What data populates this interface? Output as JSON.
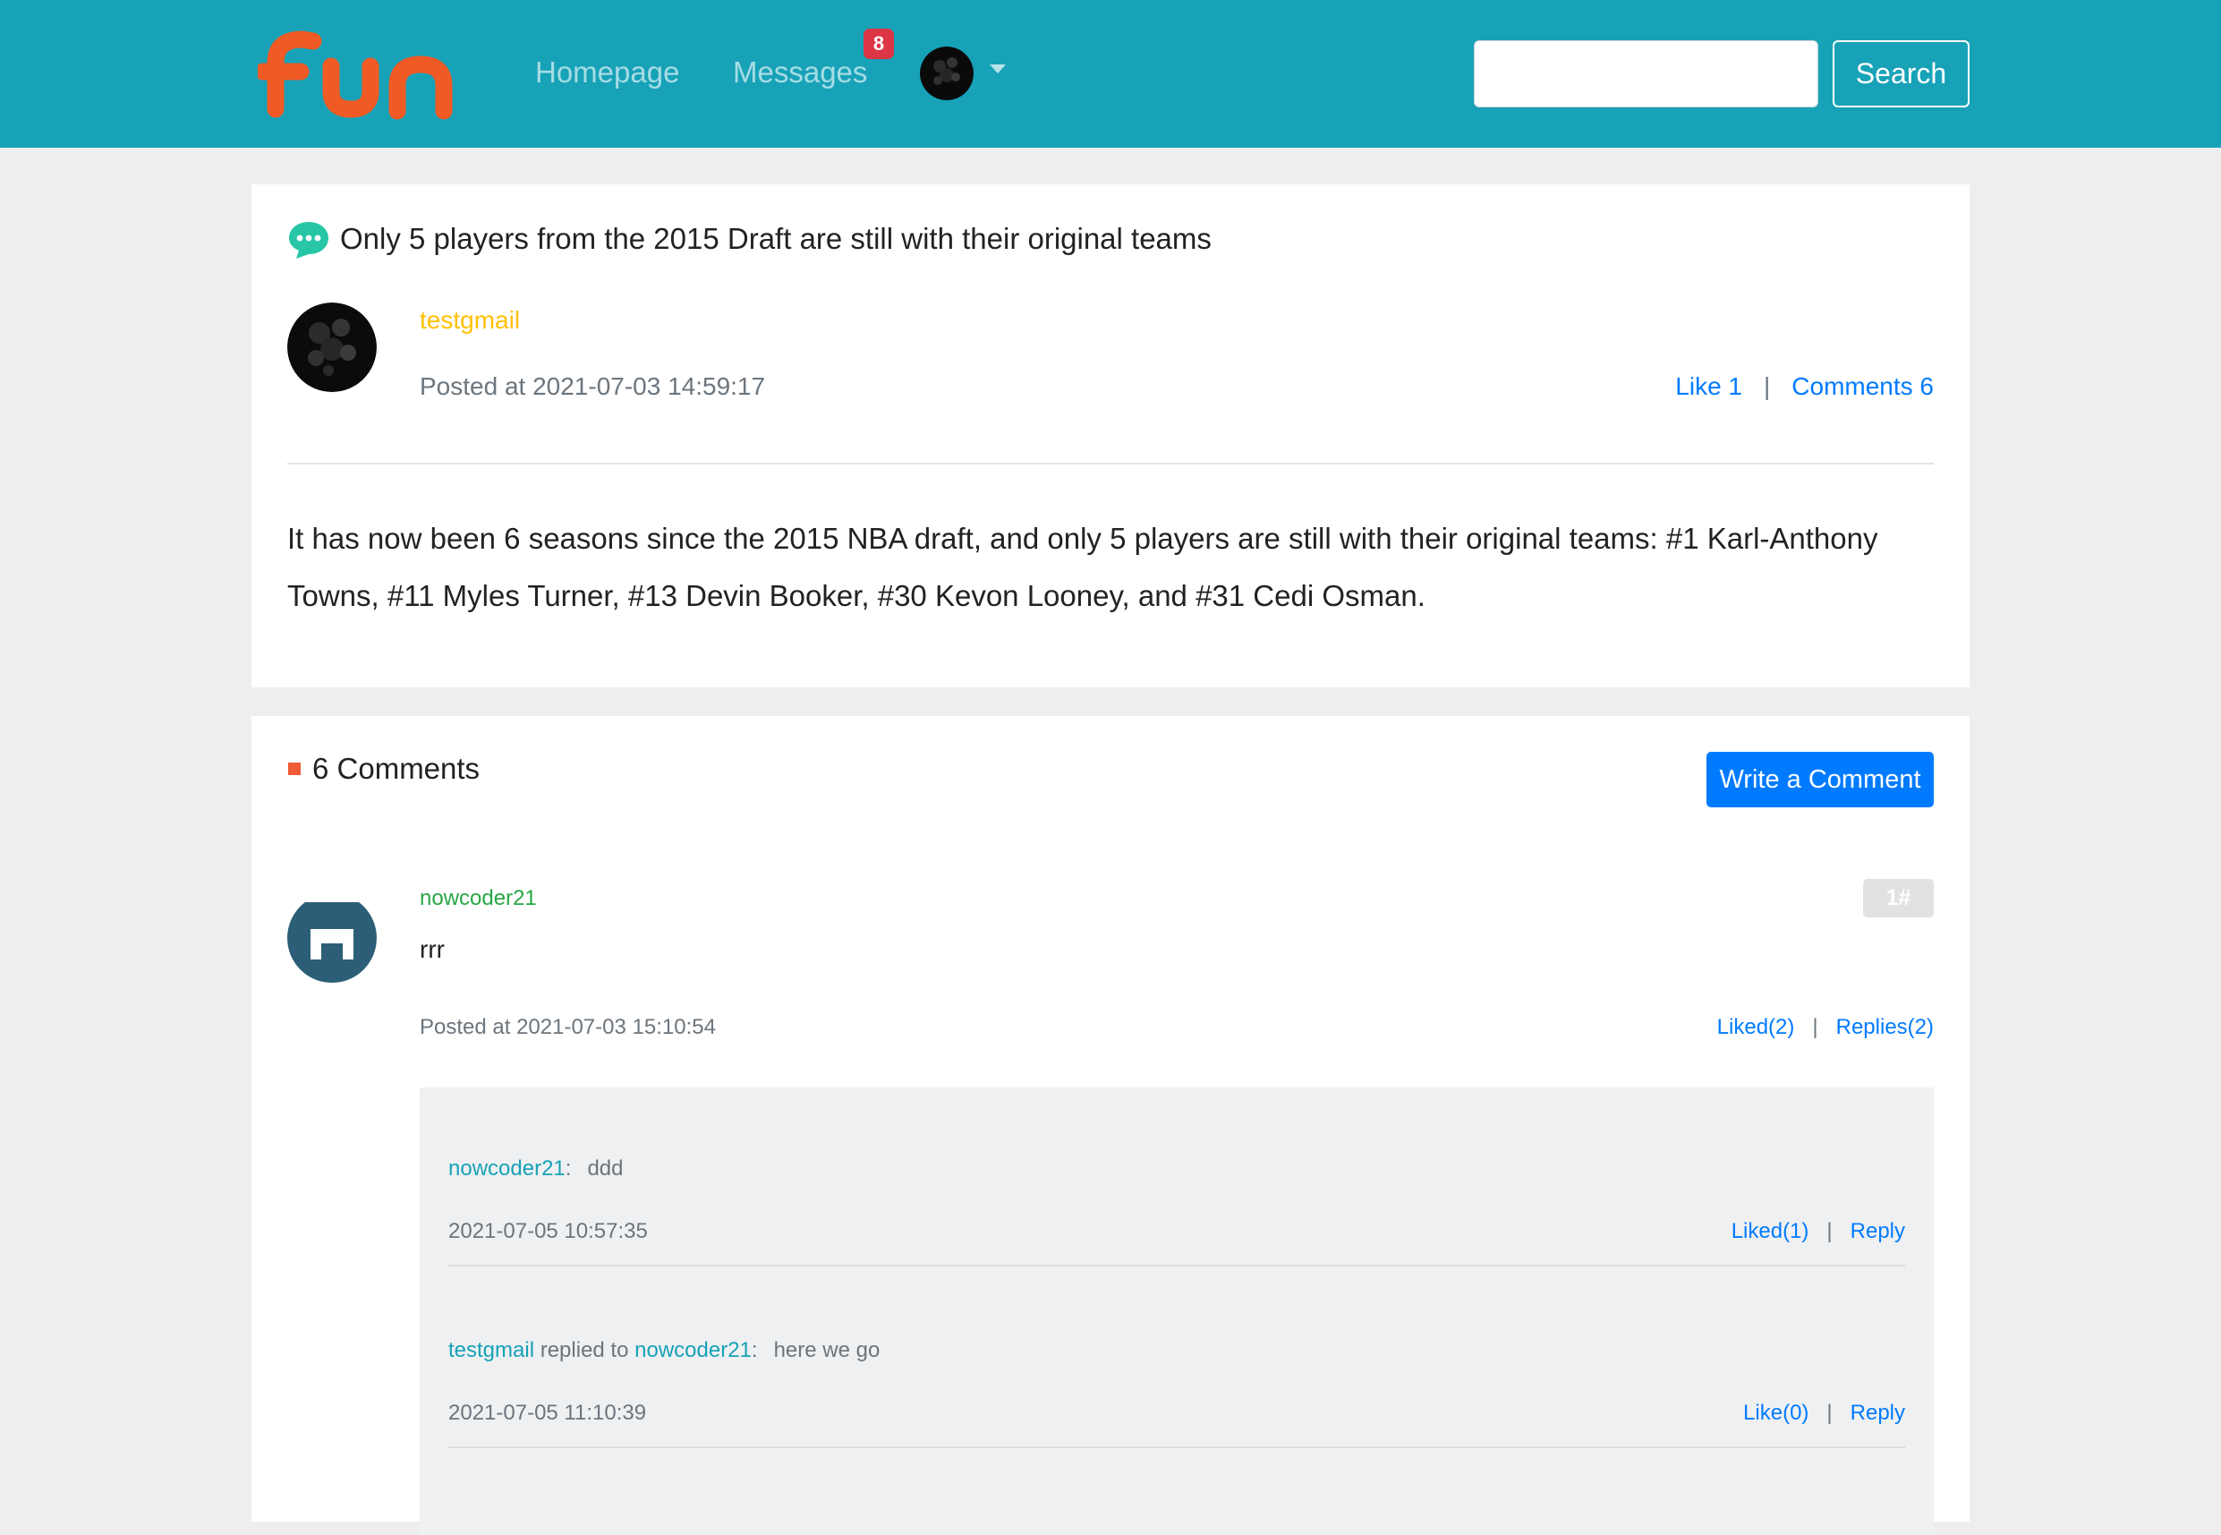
{
  "header": {
    "logo_text": "fun",
    "nav": {
      "homepage": "Homepage",
      "messages": "Messages",
      "messages_badge": "8"
    },
    "search": {
      "placeholder": "",
      "button": "Search"
    },
    "colors": {
      "bar": "#17a2b8",
      "logo": "#f05a24"
    }
  },
  "post": {
    "title": "Only 5 players from the 2015 Draft are still with their original teams",
    "author": "testgmail",
    "posted_at": "Posted at 2021-07-03 14:59:17",
    "like_label": "Like 1",
    "separator": "|",
    "comments_label": "Comments 6",
    "body": "It has now been 6 seasons since the 2015 NBA draft, and only 5 players are still with their original teams: #1 Karl-Anthony Towns, #11 Myles Turner, #13 Devin Booker, #30 Kevon Looney, and #31 Cedi Osman."
  },
  "comments": {
    "heading": "6 Comments",
    "write_button": "Write a Comment",
    "items": [
      {
        "user": "nowcoder21",
        "floor": "1#",
        "content": "rrr",
        "posted_at": "Posted at 2021-07-03 15:10:54",
        "liked_label": "Liked(2)",
        "replies_label": "Replies(2)",
        "replies": [
          {
            "user": "nowcoder21",
            "colon": ":",
            "content": "ddd",
            "time": "2021-07-05 10:57:35",
            "like_label": "Liked(1)",
            "reply_label": "Reply"
          },
          {
            "user": "testgmail",
            "replied_to_text": "replied to",
            "target": "nowcoder21",
            "colon": ":",
            "content": "here we go",
            "time": "2021-07-05 11:10:39",
            "like_label": "Like(0)",
            "reply_label": "Reply"
          }
        ]
      }
    ]
  }
}
